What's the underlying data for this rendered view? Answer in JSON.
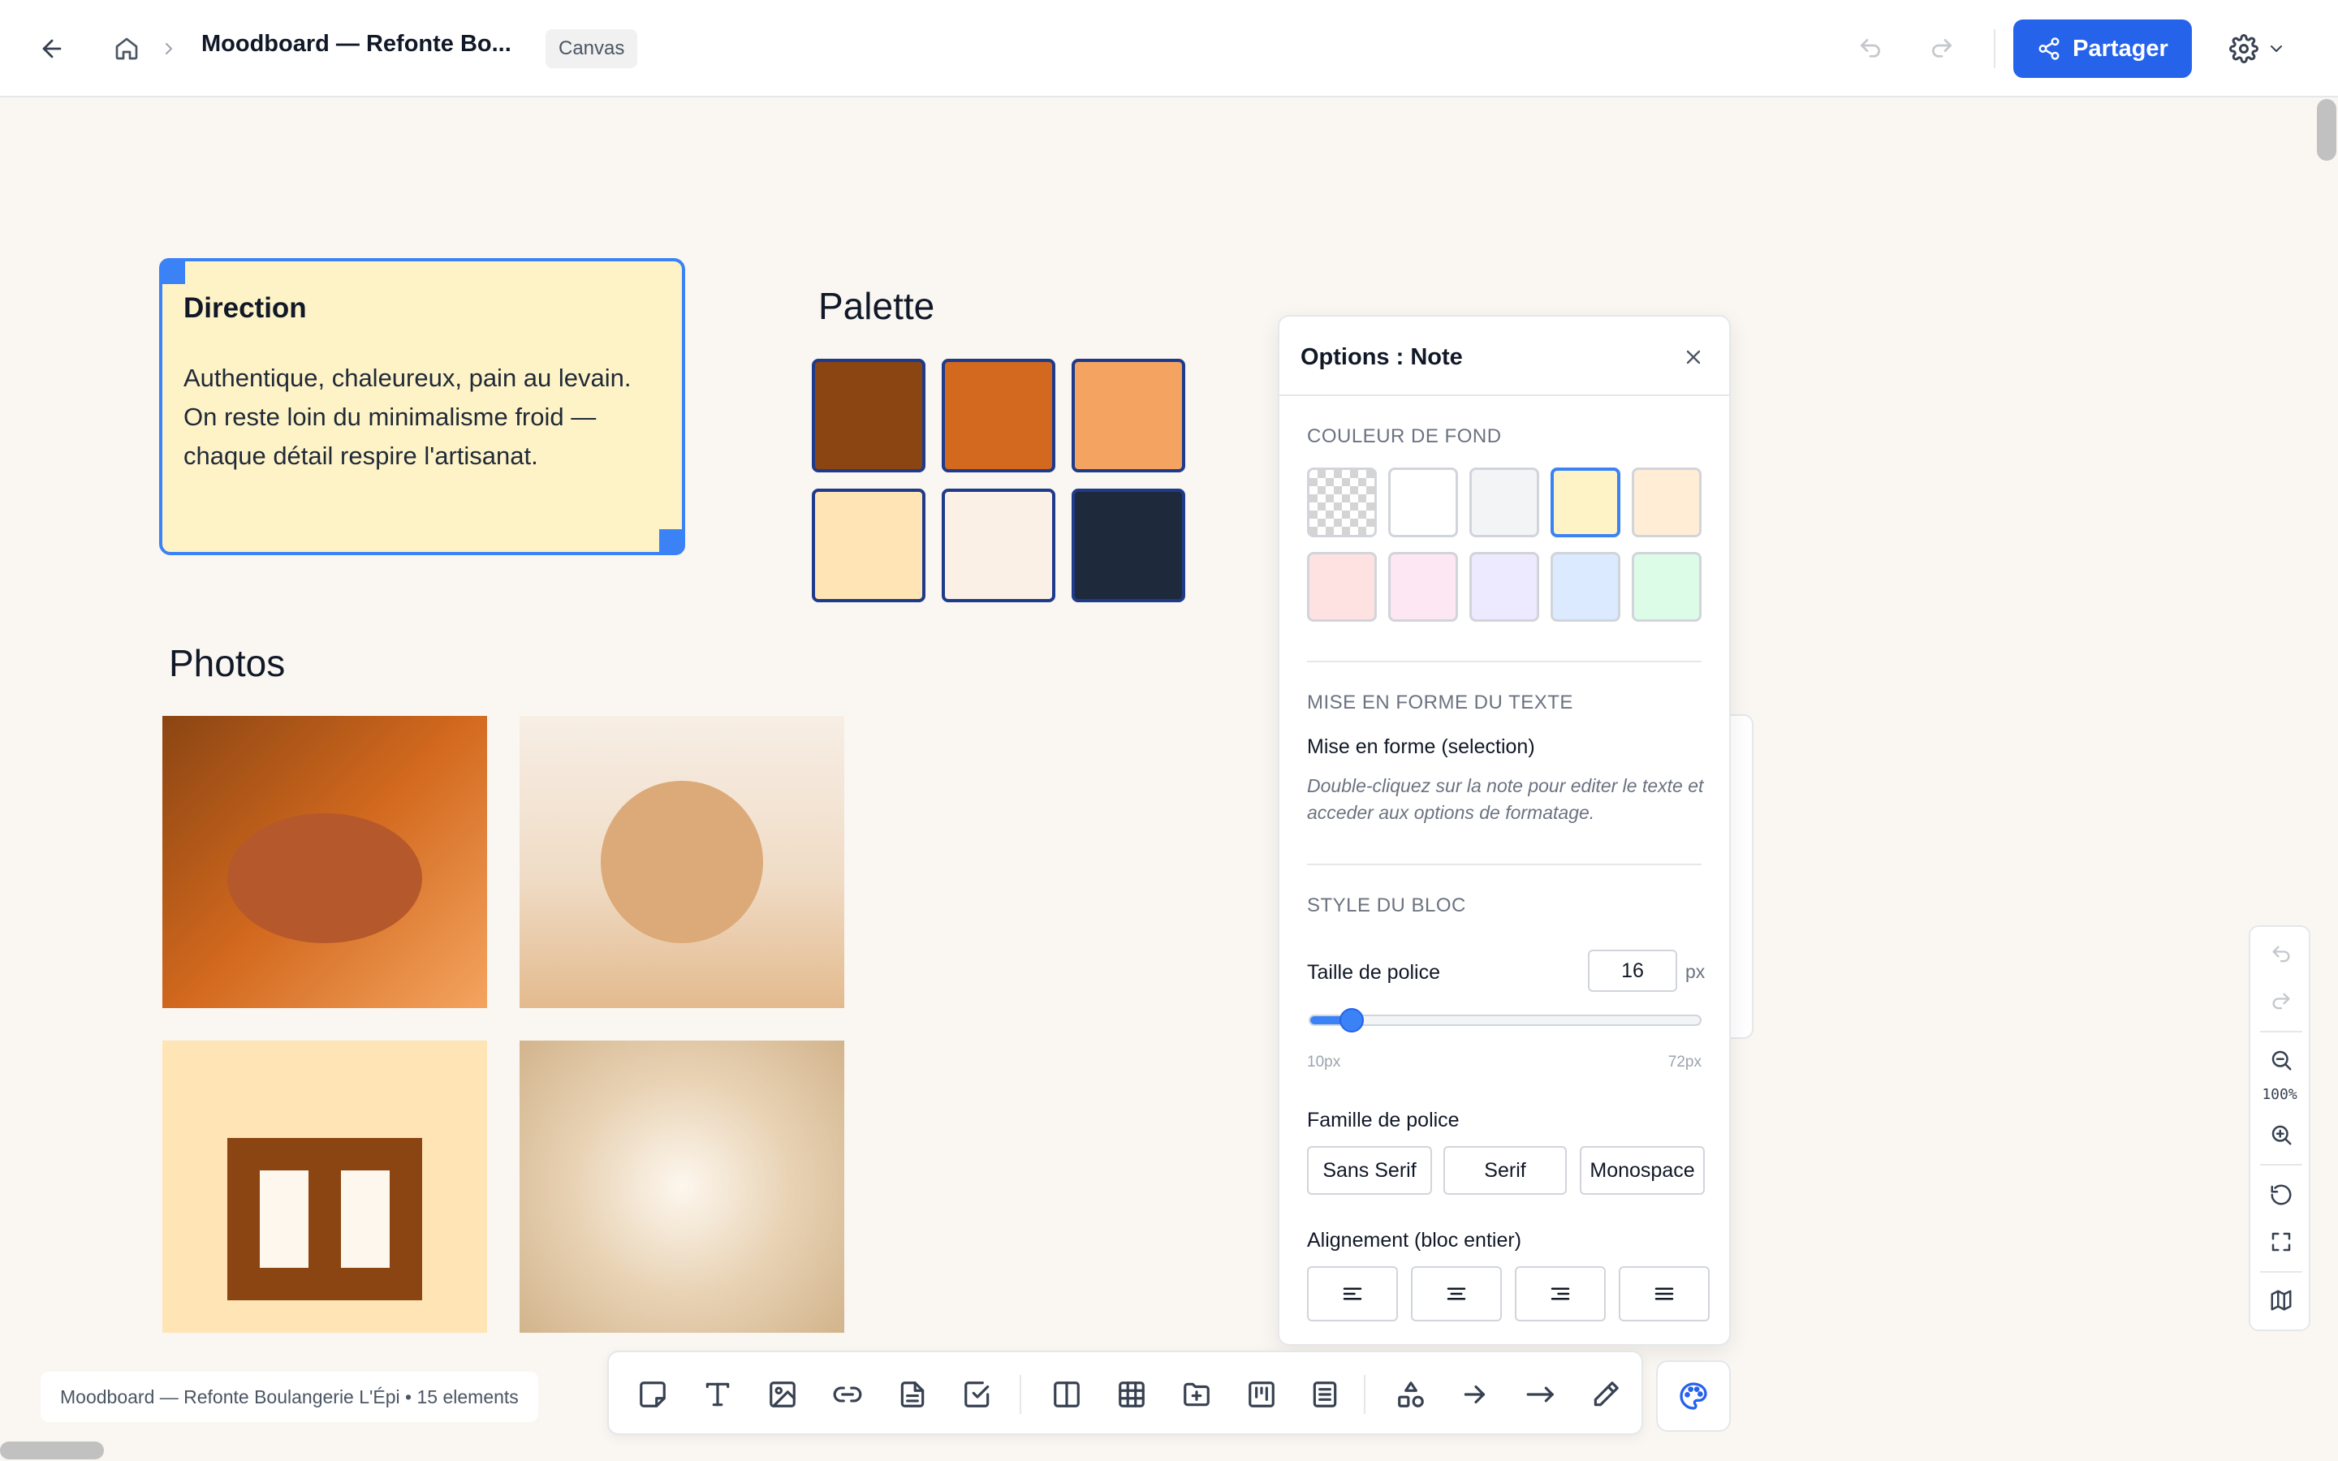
{
  "header": {
    "title": "Moodboard — Refonte Bo...",
    "badge": "Canvas",
    "share_label": "Partager"
  },
  "note": {
    "title": "Direction",
    "body": "Authentique, chaleureux, pain au levain. On reste loin du minimalisme froid — chaque détail respire l'artisanat."
  },
  "palette": {
    "title": "Palette",
    "colors": [
      "#8b4513",
      "#d2691e",
      "#f4a460",
      "#ffe4b5",
      "#faf0e6",
      "#1e293b"
    ]
  },
  "photos": {
    "title": "Photos"
  },
  "options": {
    "title": "Options : Note",
    "bg_section": "COULEUR DE FOND",
    "bg_colors": [
      "transparent",
      "#ffffff",
      "#f3f4f6",
      "#fef3c7",
      "#ffedd5",
      "#fee2e2",
      "#fce7f3",
      "#ede9fe",
      "#dbeafe",
      "#dcfce7"
    ],
    "bg_selected": "#fef3c7",
    "text_section": "MISE EN FORME DU TEXTE",
    "text_label": "Mise en forme (selection)",
    "text_hint": "Double-cliquez sur la note pour editer le texte et acceder aux options de formatage.",
    "block_section": "STYLE DU BLOC",
    "font_size_label": "Taille de police",
    "font_size_value": "16",
    "font_size_unit": "px",
    "font_size_min": "10px",
    "font_size_max": "72px",
    "font_size_fraction": 0.11,
    "font_family_label": "Famille de police",
    "font_families": [
      "Sans Serif",
      "Serif",
      "Monospace"
    ],
    "alignment_label": "Alignement (bloc entier)"
  },
  "zoom": {
    "level": "100%"
  },
  "status": {
    "text": "Moodboard — Refonte Boulangerie L'Épi • 15 elements"
  },
  "accent": "#2563eb"
}
